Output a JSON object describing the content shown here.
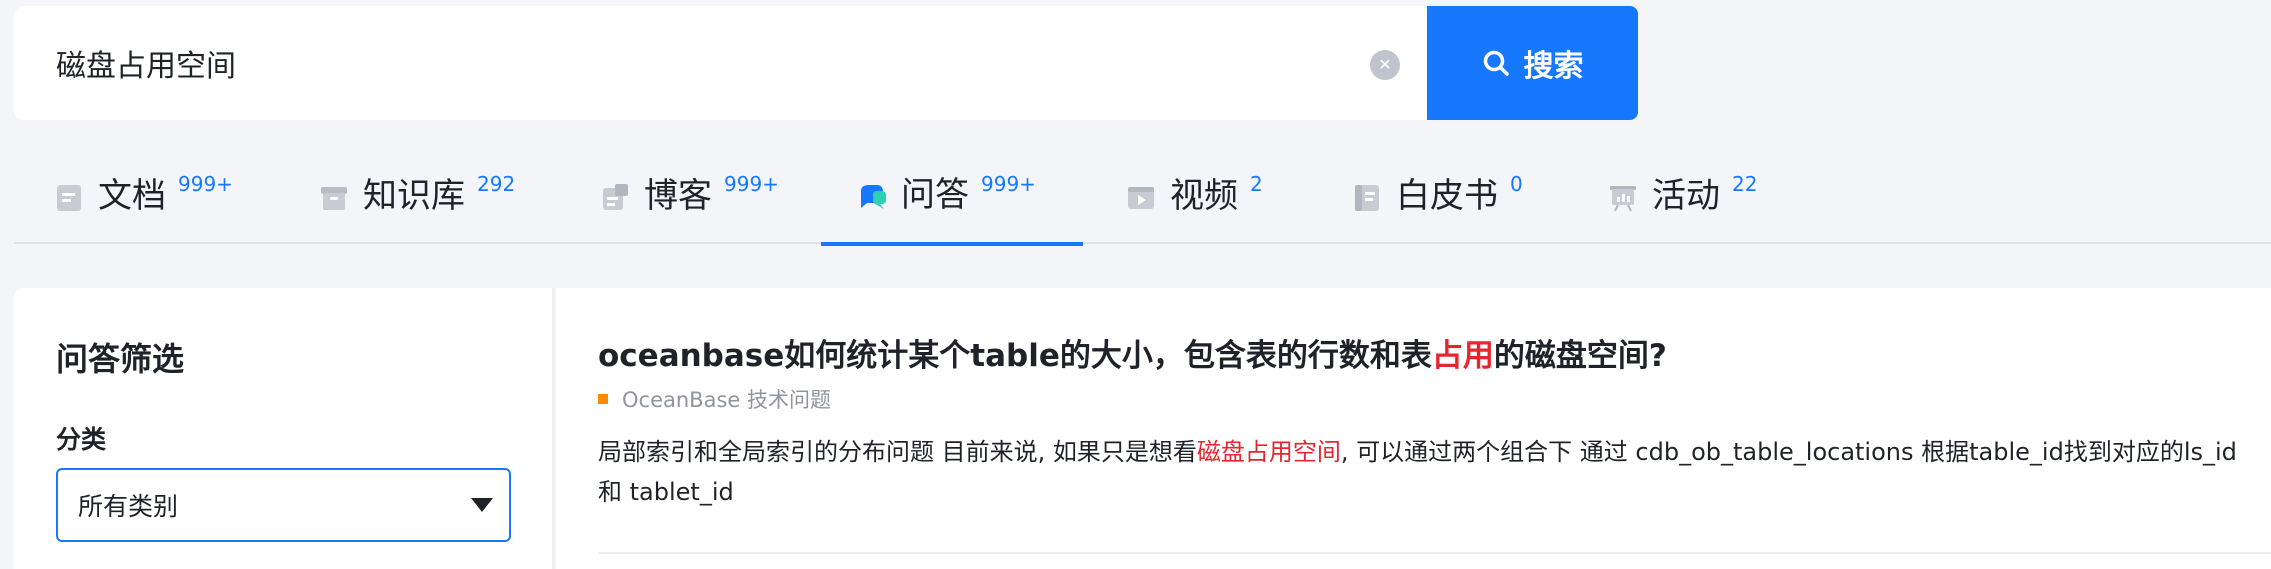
{
  "search": {
    "value": "磁盘占用空间",
    "button_label": "搜索"
  },
  "tabs": [
    {
      "label": "文档",
      "count": "999+",
      "icon": "document-icon"
    },
    {
      "label": "知识库",
      "count": "292",
      "icon": "archive-box-icon"
    },
    {
      "label": "博客",
      "count": "999+",
      "icon": "blog-icon"
    },
    {
      "label": "问答",
      "count": "999+",
      "icon": "qa-chat-icon",
      "active": true
    },
    {
      "label": "视频",
      "count": "2",
      "icon": "video-icon"
    },
    {
      "label": "白皮书",
      "count": "0",
      "icon": "whitepaper-icon"
    },
    {
      "label": "活动",
      "count": "22",
      "icon": "event-board-icon"
    }
  ],
  "sidebar": {
    "title": "问答筛选",
    "category_label": "分类",
    "category_value": "所有类别"
  },
  "result": {
    "title_prefix": "oceanbase如何统计某个table的大小，包含表的行数和表",
    "title_highlight": "占用",
    "title_suffix": "的磁盘空间?",
    "category": "OceanBase 技术问题",
    "snippet_prefix": "局部索引和全局索引的分布问题 目前来说, 如果只是想看",
    "snippet_highlight": "磁盘占用空间",
    "snippet_suffix": ", 可以通过两个组合下 通过 cdb_ob_table_locations 根据table_id找到对应的ls_id 和 tablet_id"
  },
  "colors": {
    "accent": "#1677ff",
    "highlight": "#e6262f",
    "category_dot": "#ff8a00",
    "background": "#f3f5f8"
  }
}
